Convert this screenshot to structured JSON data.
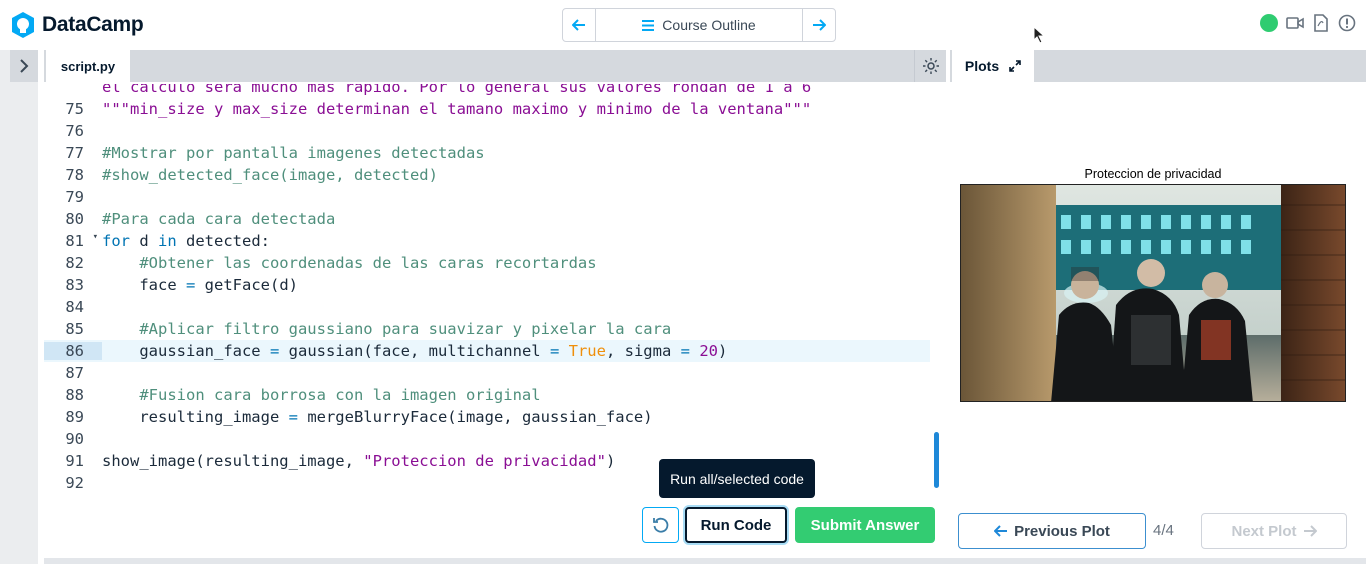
{
  "app": {
    "brand": "DataCamp"
  },
  "nav": {
    "center_label": "Course Outline"
  },
  "editor": {
    "tab_label": "script.py",
    "lines": [
      {
        "n": "",
        "tokens": [
          [
            "c-str",
            "el calculo sera mucho mas rapido. Por lo general sus valores rondan de 1 a 6"
          ]
        ]
      },
      {
        "n": "75",
        "tokens": [
          [
            "c-str",
            "\"\"\"min_size y max_size determinan el tamano maximo y minimo de la ventana\"\"\""
          ]
        ]
      },
      {
        "n": "76",
        "tokens": []
      },
      {
        "n": "77",
        "tokens": [
          [
            "c-com",
            "#Mostrar por pantalla imagenes detectadas"
          ]
        ]
      },
      {
        "n": "78",
        "tokens": [
          [
            "c-com",
            "#show_detected_face(image, detected)"
          ]
        ]
      },
      {
        "n": "79",
        "tokens": []
      },
      {
        "n": "80",
        "tokens": [
          [
            "c-com",
            "#Para cada cara detectada"
          ]
        ]
      },
      {
        "n": "81",
        "fold": true,
        "tokens": [
          [
            "c-kw",
            "for"
          ],
          [
            "c-id",
            " d "
          ],
          [
            "c-kw",
            "in"
          ],
          [
            "c-id",
            " detected:"
          ]
        ]
      },
      {
        "n": "82",
        "tokens": [
          [
            "c-id",
            "    "
          ],
          [
            "c-com",
            "#Obtener las coordenadas de las caras recortardas"
          ]
        ]
      },
      {
        "n": "83",
        "tokens": [
          [
            "c-id",
            "    face "
          ],
          [
            "c-op",
            "="
          ],
          [
            "c-id",
            " getFace(d)"
          ]
        ]
      },
      {
        "n": "84",
        "tokens": []
      },
      {
        "n": "85",
        "tokens": [
          [
            "c-id",
            "    "
          ],
          [
            "c-com",
            "#Aplicar filtro gaussiano para suavizar y pixelar la cara"
          ]
        ]
      },
      {
        "n": "86",
        "active": true,
        "tokens": [
          [
            "c-id",
            "    gaussian_face "
          ],
          [
            "c-op",
            "="
          ],
          [
            "c-id",
            " gaussian(face, multichannel "
          ],
          [
            "c-op",
            "="
          ],
          [
            "c-id",
            " "
          ],
          [
            "c-true",
            "True"
          ],
          [
            "c-id",
            ", sigma "
          ],
          [
            "c-op",
            "="
          ],
          [
            "c-id",
            " "
          ],
          [
            "c-num",
            "20"
          ],
          [
            "c-id",
            ")"
          ]
        ]
      },
      {
        "n": "87",
        "tokens": []
      },
      {
        "n": "88",
        "tokens": [
          [
            "c-id",
            "    "
          ],
          [
            "c-com",
            "#Fusion cara borrosa con la imagen original"
          ]
        ]
      },
      {
        "n": "89",
        "tokens": [
          [
            "c-id",
            "    resulting_image "
          ],
          [
            "c-op",
            "="
          ],
          [
            "c-id",
            " mergeBlurryFace(image, gaussian_face)"
          ]
        ]
      },
      {
        "n": "90",
        "tokens": []
      },
      {
        "n": "91",
        "tokens": [
          [
            "c-id",
            "show_image(resulting_image, "
          ],
          [
            "c-str",
            "\"Proteccion de privacidad\""
          ],
          [
            "c-id",
            ")"
          ]
        ]
      },
      {
        "n": "92",
        "tokens": []
      }
    ],
    "tooltip": "Run all/selected code",
    "run_label": "Run Code",
    "submit_label": "Submit Answer"
  },
  "plots": {
    "tab_label": "Plots",
    "plot_title": "Proteccion de privacidad",
    "prev_label": "Previous Plot",
    "counter": "4/4",
    "next_label": "Next Plot"
  },
  "colors": {
    "accent": "#03a9f4",
    "submit": "#33cc72",
    "status": "#2fcc71",
    "brand_text": "#05192d"
  }
}
